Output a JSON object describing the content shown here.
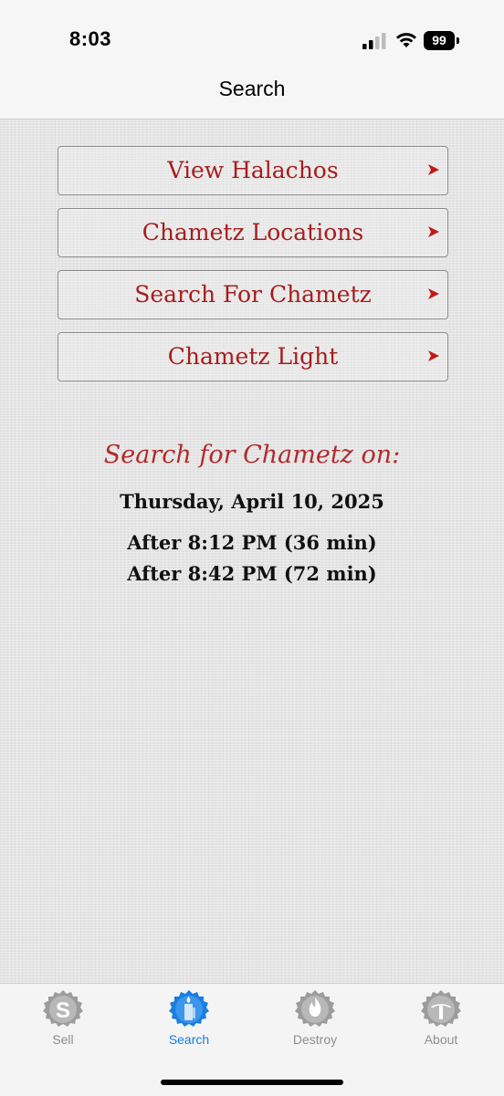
{
  "status_bar": {
    "time": "8:03",
    "battery": "99"
  },
  "nav": {
    "title": "Search"
  },
  "menu": {
    "items": [
      {
        "label": "View Halachos"
      },
      {
        "label": "Chametz Locations"
      },
      {
        "label": "Search For Chametz"
      },
      {
        "label": "Chametz Light"
      }
    ]
  },
  "search_info": {
    "heading": "Search for Chametz on:",
    "date": "Thursday, April 10, 2025",
    "times": [
      "After 8:12 PM (36 min)",
      "After 8:42 PM (72 min)"
    ]
  },
  "tabs": [
    {
      "label": "Sell",
      "icon": "sell-icon",
      "active": false
    },
    {
      "label": "Search",
      "icon": "search-candle-icon",
      "active": true
    },
    {
      "label": "Destroy",
      "icon": "fire-icon",
      "active": false
    },
    {
      "label": "About",
      "icon": "info-icon",
      "active": false
    }
  ],
  "colors": {
    "accent_red": "#a71d1d",
    "tab_active": "#1a7ee0",
    "tab_inactive": "#8e8e8e"
  }
}
